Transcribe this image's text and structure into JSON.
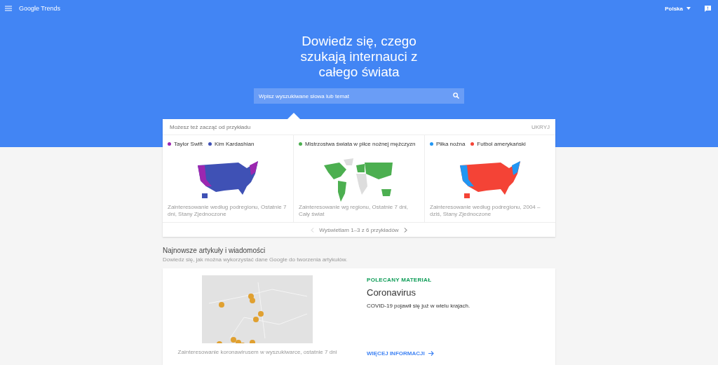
{
  "header": {
    "logo": "Google Trends",
    "country": "Polska"
  },
  "hero": {
    "title": "Dowiedz się, czego szukają internauci z całego świata",
    "search": {
      "placeholder": "Wpisz wyszukiwane słowa lub temat"
    }
  },
  "examples": {
    "intro": "Możesz też zacząć od przykładu",
    "hide": "UKRYJ",
    "cards": [
      {
        "legend": [
          {
            "label": "Taylor Swift",
            "color": "#9c27b0"
          },
          {
            "label": "Kim Kardashian",
            "color": "#3f51b5"
          }
        ],
        "caption": "Zainteresowanie według podregionu, Ostatnie 7 dni, Stany Zjednoczone"
      },
      {
        "legend": [
          {
            "label": "Mistrzostwa świata w piłce nożnej mężczyzn",
            "color": "#4caf50"
          }
        ],
        "caption": "Zainteresowanie wg regionu, Ostatnie 7 dni, Cały świat"
      },
      {
        "legend": [
          {
            "label": "Piłka nożna",
            "color": "#2196f3"
          },
          {
            "label": "Futbol amerykański",
            "color": "#f44336"
          }
        ],
        "caption": "Zainteresowanie według podregionu, 2004 – dziś, Stany Zjednoczone"
      }
    ],
    "pager": "Wyświetlam 1–3 z 6 przykładów"
  },
  "news": {
    "title": "Najnowsze artykuły i wiadomości",
    "subtitle": "Dowiedz się, jak można wykorzystać dane Google do tworzenia artykułów.",
    "card": {
      "caption": "Zainteresowanie koronawirusem w wyszukiwarce, ostatnie 7 dni",
      "label": "POLECANY MATERIAŁ",
      "title": "Coronavirus",
      "text": "COVID-19 pojawił się już w wielu krajach.",
      "link": "WIĘCEJ INFORMACJI"
    }
  }
}
